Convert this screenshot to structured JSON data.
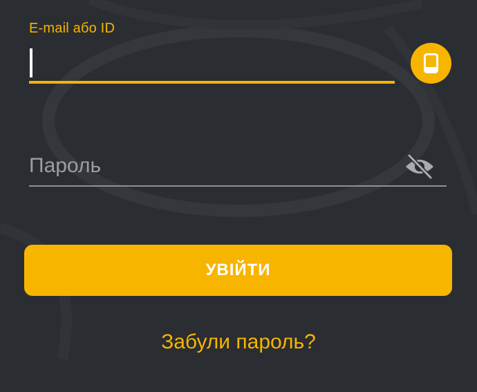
{
  "login_form": {
    "email": {
      "label": "E-mail або ID",
      "value": "",
      "placeholder": ""
    },
    "phone_toggle": {
      "icon": "smartphone-icon"
    },
    "password": {
      "value": "",
      "placeholder": "Пароль",
      "visibility_icon": "eye-off-icon"
    },
    "submit_label": "УВІЙТИ",
    "forgot_password_label": "Забули пароль?"
  },
  "colors": {
    "background": "#2a2d31",
    "accent": "#f7b500",
    "button_text": "#ffffff",
    "placeholder": "#9b9ea3",
    "underline_inactive": "#8e9196"
  }
}
